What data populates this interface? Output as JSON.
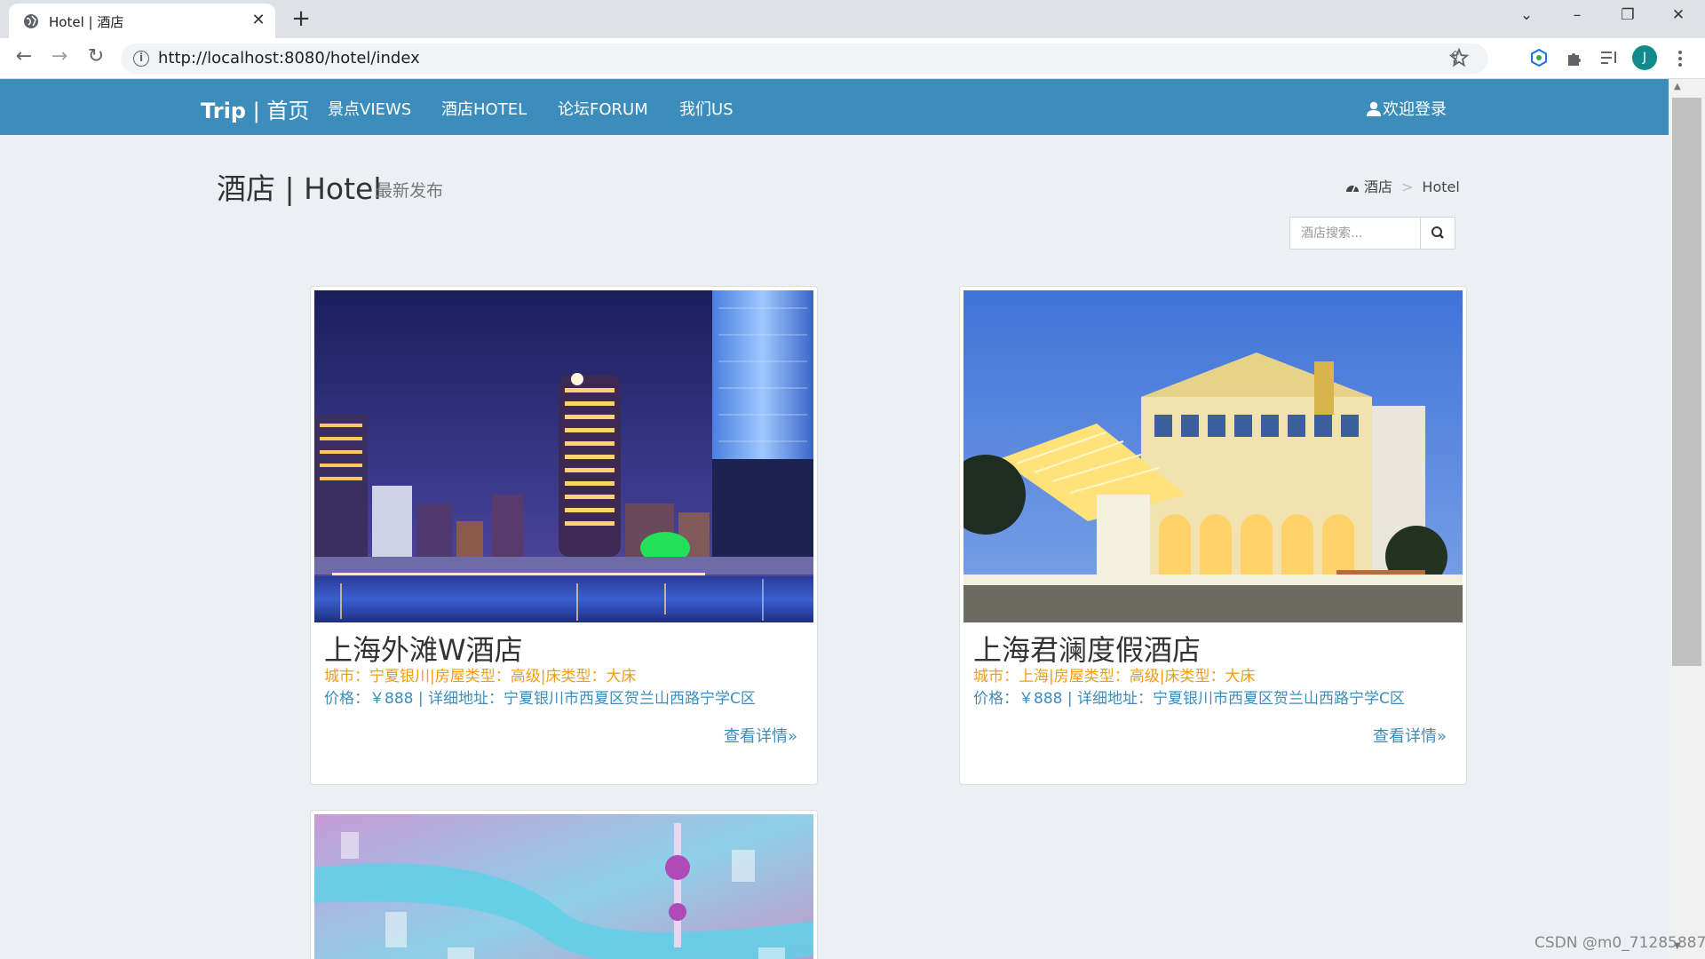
{
  "browser": {
    "tab_title": "Hotel | 酒店",
    "tab_close": "✕",
    "new_tab": "+",
    "url": "http://localhost:8080/hotel/index",
    "controls": {
      "dropdown": "⌄",
      "minimize": "–",
      "restore": "❐",
      "close": "✕"
    },
    "nav": {
      "back": "←",
      "forward": "→",
      "reload": "↻"
    },
    "profile_initial": "J"
  },
  "navbar": {
    "brand_main": "Trip",
    "brand_sub": " | 首页",
    "items": [
      {
        "label": "景点VIEWS"
      },
      {
        "label": "酒店HOTEL"
      },
      {
        "label": "论坛FORUM"
      },
      {
        "label": "我们US"
      }
    ],
    "login": "欢迎登录"
  },
  "header": {
    "title": "酒店 | Hotel",
    "subtitle": "最新发布",
    "breadcrumb": {
      "home": "酒店",
      "separator": ">",
      "current": "Hotel"
    }
  },
  "search": {
    "placeholder": "酒店搜索..."
  },
  "hotels": [
    {
      "name": "上海外滩W酒店",
      "meta": "城市：宁夏银川|房屋类型：高级|床类型：大床",
      "price_line": "价格：￥888 | 详细地址：宁夏银川市西夏区贺兰山西路宁学C区",
      "link": "查看详情»"
    },
    {
      "name": "上海君澜度假酒店",
      "meta": "城市：上海|房屋类型：高级|床类型：大床",
      "price_line": "价格：￥888 | 详细地址：宁夏银川市西夏区贺兰山西路宁学C区",
      "link": "查看详情»"
    },
    {
      "name": "",
      "meta": "",
      "price_line": "",
      "link": ""
    }
  ],
  "watermark": "CSDN @m0_71285887",
  "colors": {
    "primary": "#3c8dbc",
    "accent": "#f39c12",
    "background": "#ecf0f5"
  }
}
